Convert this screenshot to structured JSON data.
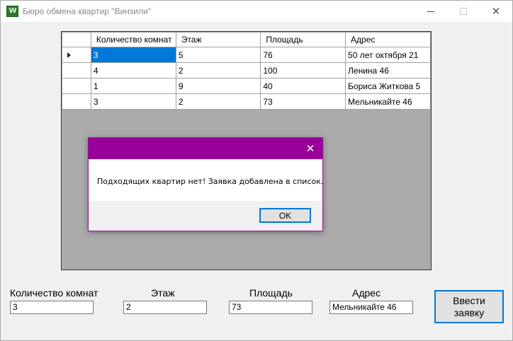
{
  "window": {
    "title": "Бюро обмена квартир \"Винзили\"",
    "icon": "app-logo-icon",
    "controls": {
      "minimize": "minimize-icon",
      "maximize": "maximize-icon",
      "close": "✕"
    }
  },
  "grid": {
    "columns": [
      "Количество комнат",
      "Этаж",
      "Площадь",
      "Адрес"
    ],
    "rows": [
      [
        "3",
        "5",
        "76",
        "50 лет октября 21"
      ],
      [
        "4",
        "2",
        "100",
        "Ленина 46"
      ],
      [
        "1",
        "9",
        "40",
        "Бориса Житкова 5"
      ],
      [
        "3",
        "2",
        "73",
        "Мельникайте 46"
      ]
    ],
    "selected_row": 0
  },
  "dialog": {
    "close": "✕",
    "message": "Подходящих квартир нет! Заявка добавлена в список.",
    "ok_label": "OK",
    "accent_color": "#990099"
  },
  "form": {
    "rooms_label": "Количество комнат",
    "floor_label": "Этаж",
    "area_label": "Площадь",
    "address_label": "Адрес",
    "rooms_value": "3",
    "floor_value": "2",
    "area_value": "73",
    "address_value": "Мельникайте 46",
    "submit_label": "Ввести заявку"
  }
}
